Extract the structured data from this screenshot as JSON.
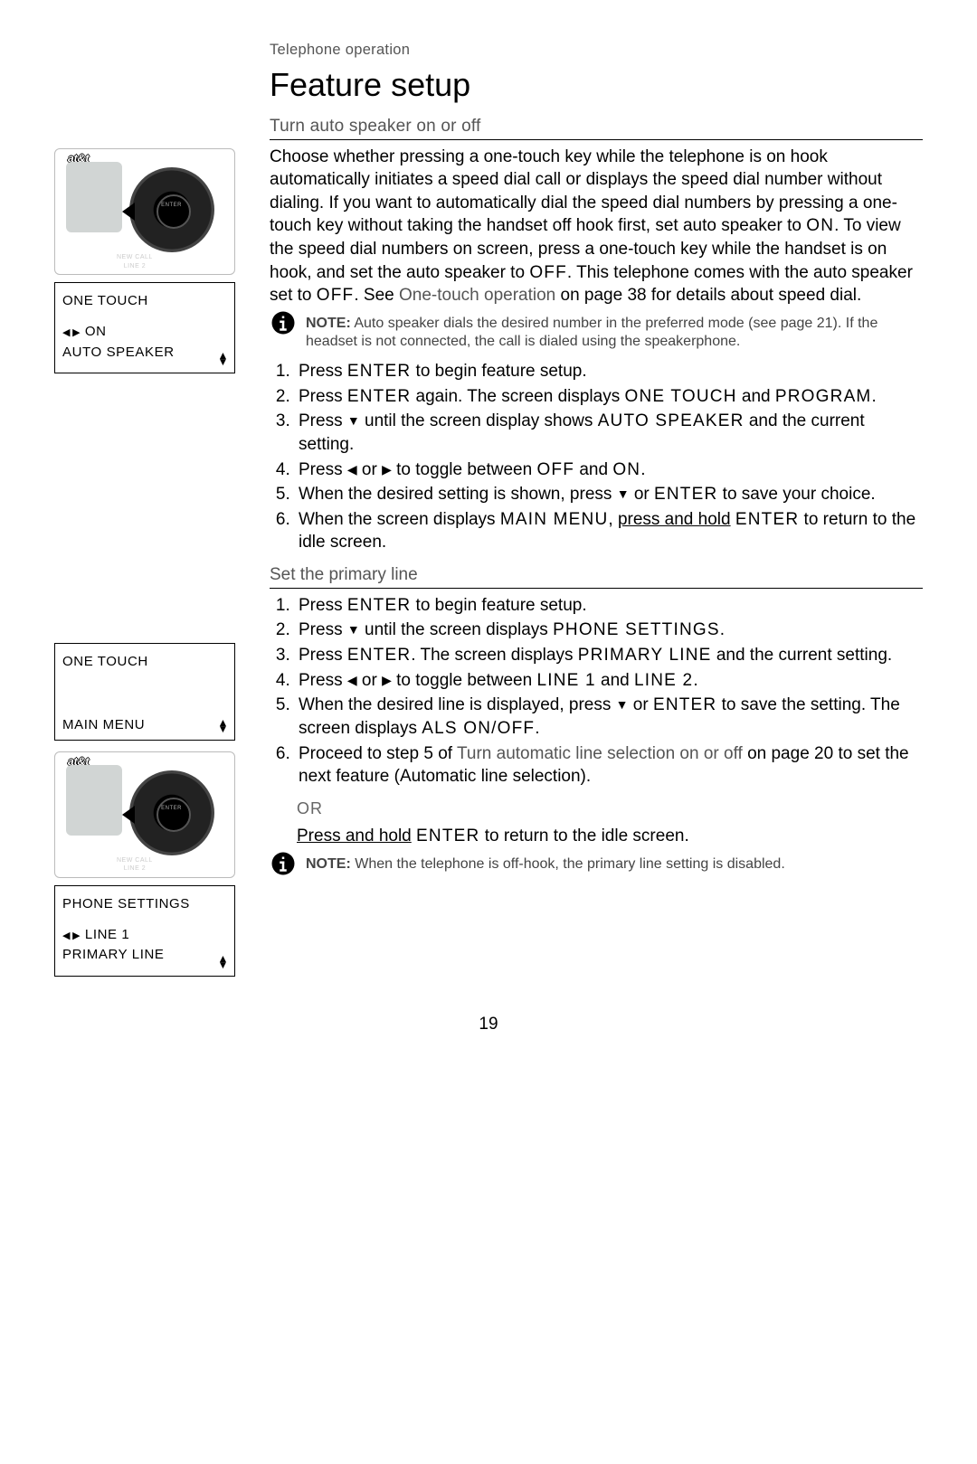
{
  "breadcrumb": "Telephone operation",
  "title": "Feature setup",
  "section1": {
    "heading": "Turn auto speaker on or off",
    "intro_parts": [
      "Choose whether pressing a one-touch key while the telephone is on hook automatically initiates a speed dial call or displays the speed dial number without dialing. If you want to automatically dial the speed dial numbers by pressing a one-touch key without taking the handset off hook first, set auto speaker to ",
      ". To view the speed dial numbers on screen, press a one-touch key while the handset is on hook, and set the auto speaker to ",
      ". This telephone comes with the auto speaker set to ",
      ". See ",
      " on page 38 for details about speed dial."
    ],
    "kw_on": "ON",
    "kw_off": "OFF",
    "ref_onetouch": "One-touch operation",
    "note_label": "NOTE:",
    "note": " Auto speaker dials the desired number in the preferred mode (see page 21). If the headset is not connected, the call is dialed using the speakerphone.",
    "steps": {
      "s1a": "Press ",
      "s1b": " to begin feature setup.",
      "s2a": "Press ",
      "s2b": " again. The screen displays ",
      "s2c": " and ",
      "s2d": ".",
      "s3a": "Press ",
      "s3b": " until the screen display shows ",
      "s3c": " and the current setting.",
      "s4a": "Press ",
      "s4b": " or ",
      "s4c": " to toggle between ",
      "s4d": " and ",
      "s4e": ".",
      "s5a": "When the desired setting is shown, press ",
      "s5b": " or ",
      "s5c": " to save your choice.",
      "s6a": "When the screen displays ",
      "s6b": ", ",
      "s6c": "press and hold",
      "s6d": " ",
      "s6e": " to return to the idle screen."
    },
    "kw_enter": "ENTER",
    "kw_onetouch": "ONE TOUCH",
    "kw_program": "PROGRAM",
    "kw_autospeaker": "AUTO SPEAKER",
    "kw_mainmenu": "MAIN MENU"
  },
  "section2": {
    "heading": "Set the primary line",
    "steps": {
      "s1a": "Press ",
      "s1b": " to begin feature setup.",
      "s2a": "Press ",
      "s2b": " until the screen displays ",
      "s2c": ".",
      "s3a": "Press ",
      "s3b": ". The screen displays ",
      "s3c": " and the current setting.",
      "s4a": "Press ",
      "s4b": " or ",
      "s4c": " to toggle between ",
      "s4d": " and ",
      "s4e": ".",
      "s5a": "When the desired line is displayed, press ",
      "s5b": " or ",
      "s5c": " to save the setting. The screen displays ",
      "s5d": ".",
      "s6a": "Proceed to step 5 of ",
      "s6b": " on page 20 to set the next feature (Automatic line selection)."
    },
    "kw_enter": "ENTER",
    "kw_phonesettings": "PHONE SETTINGS",
    "kw_primaryline": "PRIMARY LINE",
    "kw_line1": "LINE 1",
    "kw_line2": "LINE 2",
    "kw_als": "ALS ON/OFF",
    "ref_auto": "Turn automatic line selection on or off",
    "or_label": "OR",
    "press_hold": "Press and hold",
    "return_idle": " to return to the idle screen.",
    "note_label": "NOTE:",
    "note": " When the telephone is off-hook, the primary line setting is disabled."
  },
  "sidebar": {
    "brand": "at&t",
    "enter": "ENTER",
    "newcall": "NEW CALL\nLINE 2",
    "lcd1": {
      "l1": "ONE TOUCH",
      "l2": "ON",
      "l3": "AUTO SPEAKER"
    },
    "lcd2": {
      "l1": "ONE TOUCH",
      "l2": "MAIN MENU"
    },
    "lcd3": {
      "l1": "PHONE SETTINGS",
      "l2": "LINE 1",
      "l3": "PRIMARY LINE"
    }
  },
  "page_number": "19",
  "glyphs": {
    "down": "▼",
    "left": "◀",
    "right": "▶"
  }
}
